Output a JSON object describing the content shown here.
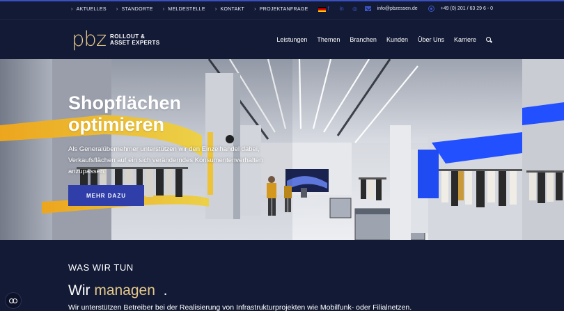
{
  "topbar": {
    "links": [
      "AKTUELLES",
      "STANDORTE",
      "MELDESTELLE",
      "KONTAKT",
      "PROJEKTANFRAGE"
    ],
    "email": "info@pbzessen.de",
    "phone": "+49 (0) 201 / 63 29 6 - 0",
    "social_glyphs": [
      "f",
      "in",
      "◎"
    ],
    "flag_colors": [
      "#000000",
      "#dd0000",
      "#ffce00"
    ]
  },
  "header": {
    "logo_mark": "pbz",
    "logo_line1": "ROLLOUT &",
    "logo_line2": "ASSET EXPERTS",
    "nav": [
      "Leistungen",
      "Themen",
      "Branchen",
      "Kunden",
      "Über Uns",
      "Karriere"
    ]
  },
  "hero": {
    "title": "Shopflächen optimieren",
    "text": "Als Generalübernehmer unterstützen wir den Einzelhandel dabei, Verkaufsflächen auf ein sich veränderndes Konsumentenverhalten anzupassen.",
    "button_label": "MEHR DAZU"
  },
  "section": {
    "heading": "WAS WIR TUN",
    "sub_prefix": "Wir ",
    "sub_highlight": "managen",
    "sub_suffix": "  .",
    "description": "Wir unterstützen Betreiber bei der Realisierung von Infrastrukturprojekten wie Mobilfunk- oder Filialnetzen."
  },
  "colors": {
    "background": "#131a36",
    "accent_gold": "#e6c98b",
    "button_blue": "#2f3ea8",
    "social_blue": "#3a55c6"
  }
}
